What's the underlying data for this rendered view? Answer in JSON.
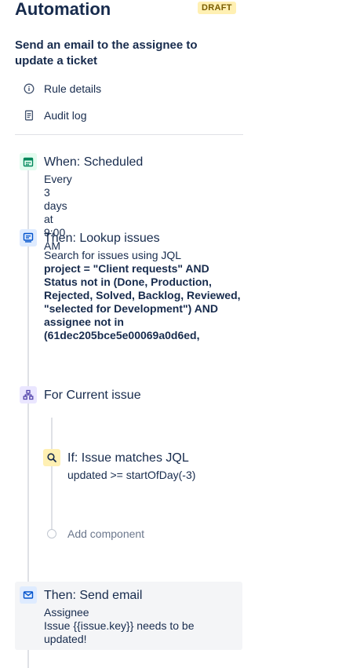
{
  "header": {
    "title": "Automation",
    "badge": "DRAFT"
  },
  "rule": {
    "name": "Send an email to the assignee to update a ticket"
  },
  "menu": {
    "rule_details": "Rule details",
    "audit_log": "Audit log"
  },
  "steps": {
    "trigger": {
      "title": "When: Scheduled",
      "desc": "Every 3 days at 9:00 AM",
      "icon": "calendar-icon"
    },
    "lookup": {
      "title": "Then: Lookup issues",
      "desc": "Search for issues using JQL",
      "jql": "project = \"Client requests\" AND Status not in (Done, Production, Rejected, Solved, Backlog, Reviewed, \"selected for Development\") AND assignee not in (61dec205bce5e00069a0d6ed,",
      "icon": "lookup-issues-icon"
    },
    "branch": {
      "title": "For Current issue",
      "icon": "branch-icon"
    },
    "condition": {
      "title": "If: Issue matches JQL",
      "desc": "updated >= startOfDay(-3)",
      "icon": "search-icon"
    },
    "add_component": "Add component",
    "email": {
      "title": "Then: Send email",
      "to": "Assignee",
      "subject": "Issue {{issue.key}} needs to be updated!",
      "icon": "envelope-icon"
    }
  },
  "colors": {
    "trigger_accent": "#00875a",
    "action_accent": "#0052cc",
    "branch_accent": "#5243aa",
    "condition_bg": "#fff0b3",
    "draft_badge_bg": "#fff0b3"
  }
}
